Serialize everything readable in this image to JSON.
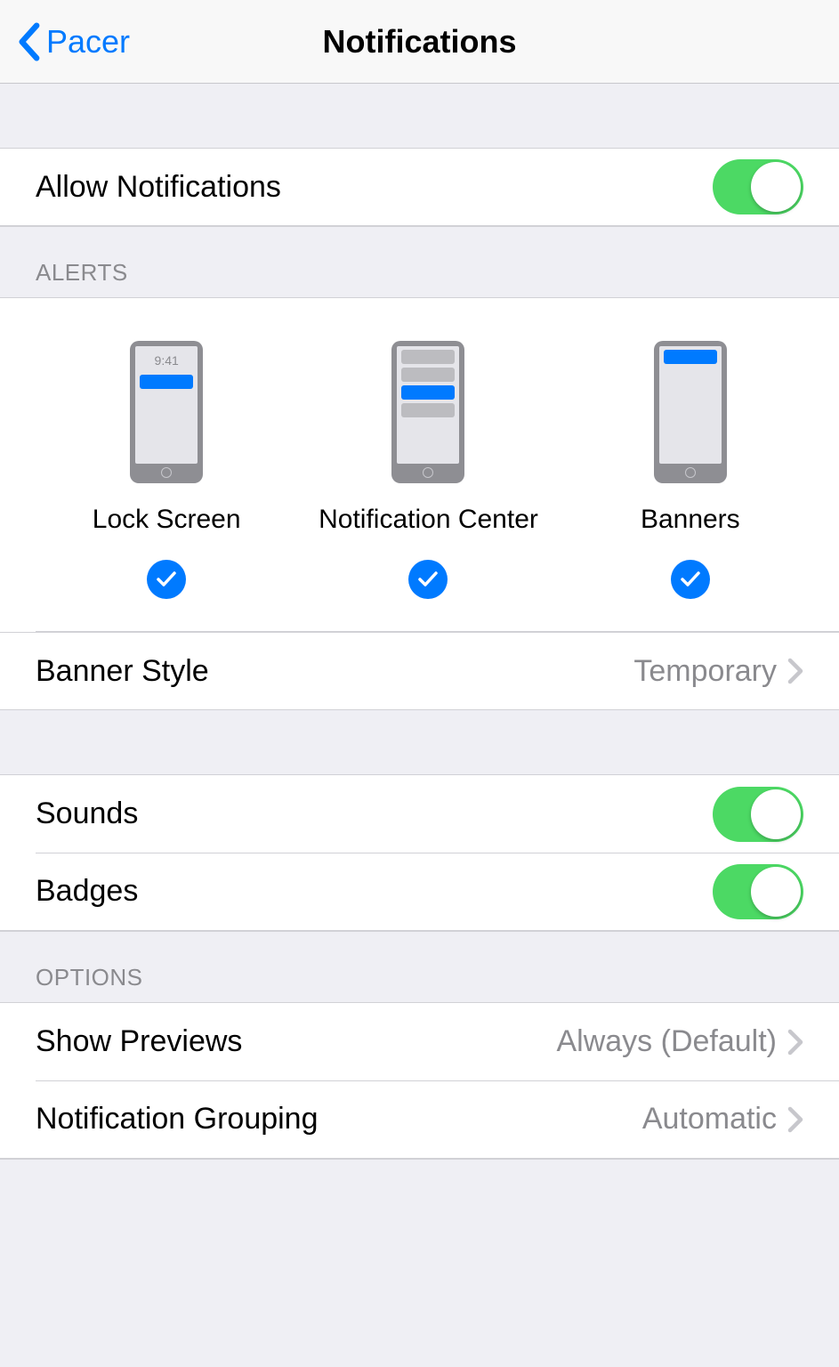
{
  "nav": {
    "back_label": "Pacer",
    "title": "Notifications"
  },
  "allow": {
    "label": "Allow Notifications",
    "on": true
  },
  "alerts": {
    "header": "ALERTS",
    "lock_time": "9:41",
    "options": [
      {
        "label": "Lock Screen",
        "checked": true
      },
      {
        "label": "Notification Center",
        "checked": true
      },
      {
        "label": "Banners",
        "checked": true
      }
    ],
    "banner_style": {
      "label": "Banner Style",
      "value": "Temporary"
    }
  },
  "sounds": {
    "label": "Sounds",
    "on": true
  },
  "badges": {
    "label": "Badges",
    "on": true
  },
  "options": {
    "header": "OPTIONS",
    "show_previews": {
      "label": "Show Previews",
      "value": "Always (Default)"
    },
    "grouping": {
      "label": "Notification Grouping",
      "value": "Automatic"
    }
  }
}
